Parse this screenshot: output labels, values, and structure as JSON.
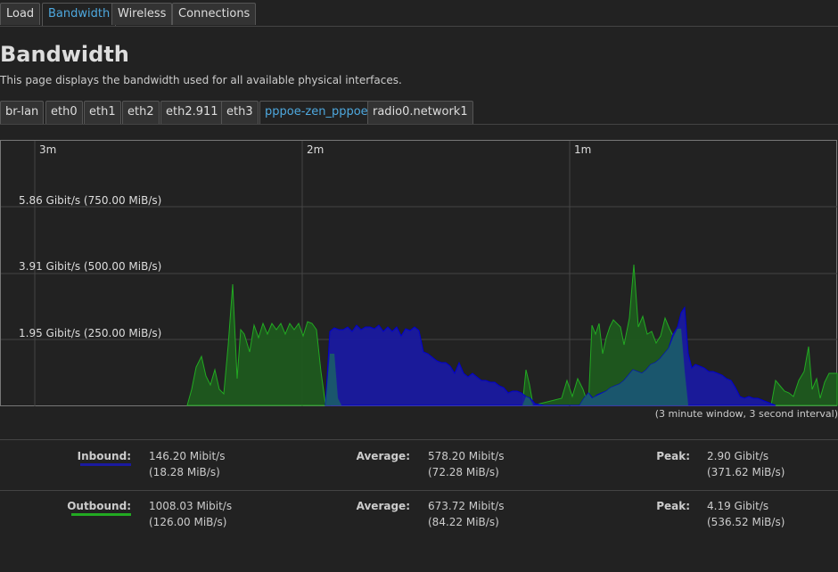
{
  "top_tabs": [
    {
      "label": "Load",
      "active": false
    },
    {
      "label": "Bandwidth",
      "active": true
    },
    {
      "label": "Wireless",
      "active": false
    },
    {
      "label": "Connections",
      "active": false
    }
  ],
  "page": {
    "title": "Bandwidth",
    "description": "This page displays the bandwidth used for all available physical interfaces."
  },
  "interfaces": [
    {
      "label": "br-lan",
      "active": false
    },
    {
      "label": "eth0",
      "active": false
    },
    {
      "label": "eth1",
      "active": false
    },
    {
      "label": "eth2",
      "active": false
    },
    {
      "label": "eth2.911",
      "active": false
    },
    {
      "label": "eth3",
      "active": false
    },
    {
      "label": "pppoe-zen_pppoe",
      "active": true
    },
    {
      "label": "radio0.network1",
      "active": false
    }
  ],
  "graph": {
    "time_labels": [
      "3m",
      "2m",
      "1m"
    ],
    "y_labels": [
      "5.86 Gibit/s (750.00 MiB/s)",
      "3.91 Gibit/s (500.00 MiB/s)",
      "1.95 Gibit/s (250.00 MiB/s)"
    ],
    "window_note": "(3 minute window, 3 second interval)",
    "colors": {
      "inbound_fill": "#1a1aa0",
      "inbound_line": "#0000d0",
      "outbound_fill": "#1f5a1f",
      "outbound_line": "#22aa22",
      "overlap_fill": "#1a5a6a"
    }
  },
  "stats": {
    "inbound": {
      "label": "Inbound:",
      "current_bits": "146.20 Mibit/s",
      "current_bytes": "(18.28 MiB/s)",
      "average_label": "Average:",
      "average_bits": "578.20 Mibit/s",
      "average_bytes": "(72.28 MiB/s)",
      "peak_label": "Peak:",
      "peak_bits": "2.90 Gibit/s",
      "peak_bytes": "(371.62 MiB/s)",
      "color": "#1a1aa0"
    },
    "outbound": {
      "label": "Outbound:",
      "current_bits": "1008.03 Mibit/s",
      "current_bytes": "(126.00 MiB/s)",
      "average_label": "Average:",
      "average_bits": "673.72 Mibit/s",
      "average_bytes": "(84.22 MiB/s)",
      "peak_label": "Peak:",
      "peak_bits": "4.19 Gibit/s",
      "peak_bytes": "(536.52 MiB/s)",
      "color": "#22aa22"
    }
  }
}
